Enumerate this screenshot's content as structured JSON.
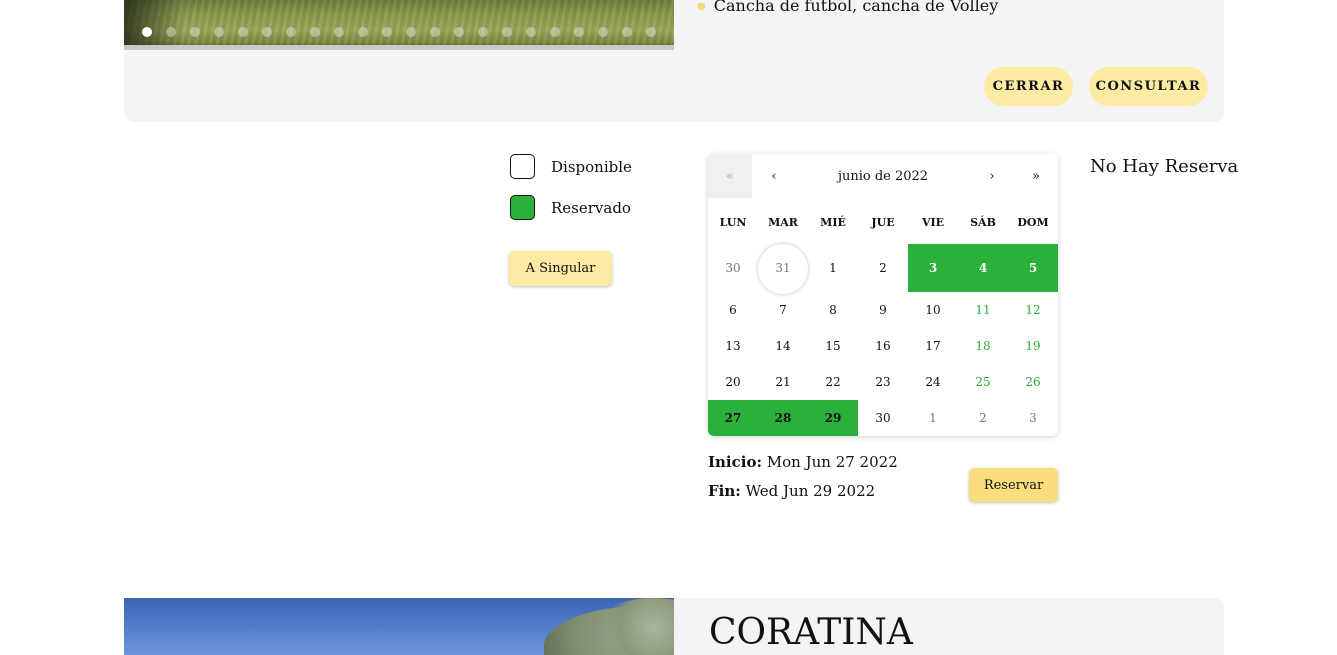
{
  "top_listing": {
    "amenity": "Cancha de futbol, cancha de Volley",
    "carousel_dot_count": 22,
    "carousel_active_index": 0,
    "close_label": "CERRAR",
    "consult_label": "CONSULTAR"
  },
  "legend": {
    "available_label": "Disponible",
    "reserved_label": "Reservado",
    "singular_label": "A Singular"
  },
  "calendar": {
    "nav_prev2": "«",
    "nav_prev": "‹",
    "month_label": "junio de 2022",
    "nav_next": "›",
    "nav_next2": "»",
    "weekdays": [
      "LUN",
      "MAR",
      "MIÉ",
      "JUE",
      "VIE",
      "SÁB",
      "DOM"
    ],
    "weeks": [
      [
        {
          "d": "30",
          "t": "muted"
        },
        {
          "d": "31",
          "t": "muted today"
        },
        {
          "d": "1",
          "t": ""
        },
        {
          "d": "2",
          "t": ""
        },
        {
          "d": "3",
          "t": "booked white"
        },
        {
          "d": "4",
          "t": "booked white"
        },
        {
          "d": "5",
          "t": "booked white"
        }
      ],
      [
        {
          "d": "6",
          "t": ""
        },
        {
          "d": "7",
          "t": ""
        },
        {
          "d": "8",
          "t": ""
        },
        {
          "d": "9",
          "t": ""
        },
        {
          "d": "10",
          "t": ""
        },
        {
          "d": "11",
          "t": "weekend"
        },
        {
          "d": "12",
          "t": "weekend"
        }
      ],
      [
        {
          "d": "13",
          "t": ""
        },
        {
          "d": "14",
          "t": ""
        },
        {
          "d": "15",
          "t": ""
        },
        {
          "d": "16",
          "t": ""
        },
        {
          "d": "17",
          "t": ""
        },
        {
          "d": "18",
          "t": "weekend"
        },
        {
          "d": "19",
          "t": "weekend"
        }
      ],
      [
        {
          "d": "20",
          "t": ""
        },
        {
          "d": "21",
          "t": ""
        },
        {
          "d": "22",
          "t": ""
        },
        {
          "d": "23",
          "t": ""
        },
        {
          "d": "24",
          "t": ""
        },
        {
          "d": "25",
          "t": "weekend"
        },
        {
          "d": "26",
          "t": "weekend"
        }
      ],
      [
        {
          "d": "27",
          "t": "booked"
        },
        {
          "d": "28",
          "t": "booked"
        },
        {
          "d": "29",
          "t": "booked"
        },
        {
          "d": "30",
          "t": ""
        },
        {
          "d": "1",
          "t": "muted"
        },
        {
          "d": "2",
          "t": "muted"
        },
        {
          "d": "3",
          "t": "muted"
        }
      ]
    ]
  },
  "booking": {
    "start_label": "Inicio:",
    "start_value": "Mon Jun 27 2022",
    "end_label": "Fin:",
    "end_value": "Wed Jun 29 2022",
    "reserve_label": "Reservar",
    "no_reservation": "No Hay Reserva"
  },
  "next_listing": {
    "title": "CORATINA"
  },
  "colors": {
    "booked": "#2ab13b",
    "button": "#fdeaa3",
    "card": "#f4f4f4"
  }
}
